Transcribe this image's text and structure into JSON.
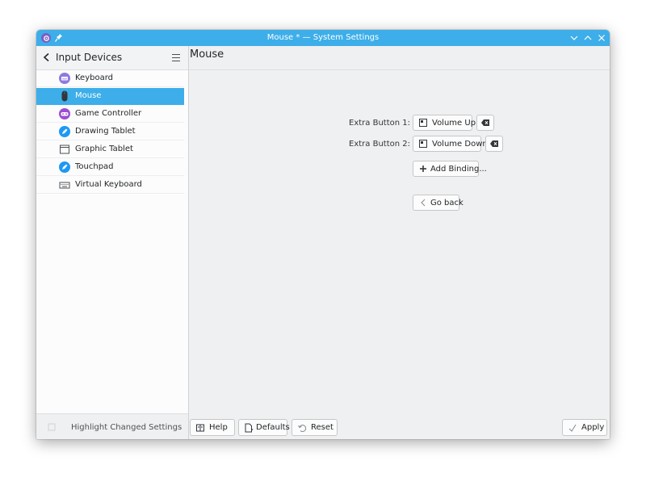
{
  "window": {
    "title": "Mouse * — System Settings",
    "accent": "#3daee9"
  },
  "sidebar": {
    "header_title": "Input Devices",
    "items": [
      {
        "label": "Keyboard",
        "icon": "keyboard-icon",
        "active": false
      },
      {
        "label": "Mouse",
        "icon": "mouse-icon",
        "active": true
      },
      {
        "label": "Game Controller",
        "icon": "game-controller-icon",
        "active": false
      },
      {
        "label": "Drawing Tablet",
        "icon": "drawing-tablet-icon",
        "active": false
      },
      {
        "label": "Graphic Tablet",
        "icon": "graphic-tablet-icon",
        "active": false
      },
      {
        "label": "Touchpad",
        "icon": "touchpad-icon",
        "active": false
      },
      {
        "label": "Virtual Keyboard",
        "icon": "virtual-keyboard-icon",
        "active": false
      }
    ],
    "highlight_label": "Highlight Changed Settings"
  },
  "content": {
    "page_title": "Mouse",
    "bindings": [
      {
        "label": "Extra Button 1:",
        "action": "Volume Up"
      },
      {
        "label": "Extra Button 2:",
        "action": "Volume Down"
      }
    ],
    "add_binding_label": "Add Binding...",
    "go_back_label": "Go back"
  },
  "footer": {
    "help_label": "Help",
    "defaults_label": "Defaults",
    "reset_label": "Reset",
    "apply_label": "Apply"
  }
}
